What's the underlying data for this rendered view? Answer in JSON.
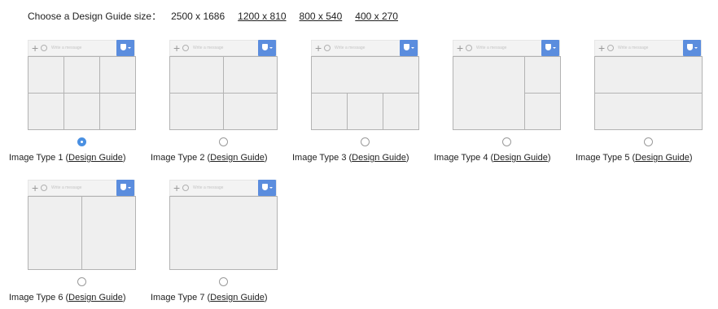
{
  "size_bar": {
    "label": "Choose a Design Guide size：",
    "options": [
      {
        "text": "2500 x 1686",
        "link": false
      },
      {
        "text": "1200 x 810",
        "link": true
      },
      {
        "text": "800 x 540",
        "link": true
      },
      {
        "text": "400 x 270",
        "link": true
      }
    ]
  },
  "preview": {
    "message_placeholder": "Write a message",
    "add_glyph": "+"
  },
  "image_types": [
    {
      "prefix": "Image Type 1 (",
      "link": "Design Guide",
      "suffix": ")",
      "selected": true
    },
    {
      "prefix": "Image Type 2 (",
      "link": "Design Guide",
      "suffix": ")",
      "selected": false
    },
    {
      "prefix": "Image Type 3 (",
      "link": "Design Guide",
      "suffix": ")",
      "selected": false
    },
    {
      "prefix": "Image Type 4 (",
      "link": "Design Guide",
      "suffix": ")",
      "selected": false
    },
    {
      "prefix": "Image Type 5 (",
      "link": "Design Guide",
      "suffix": ")",
      "selected": false
    },
    {
      "prefix": "Image Type 6 (",
      "link": "Design Guide",
      "suffix": ")",
      "selected": false
    },
    {
      "prefix": "Image Type 7 (",
      "link": "Design Guide",
      "suffix": ")",
      "selected": false
    }
  ],
  "colors": {
    "accent": "#5b8dde",
    "radio_selected": "#4a90e2"
  }
}
